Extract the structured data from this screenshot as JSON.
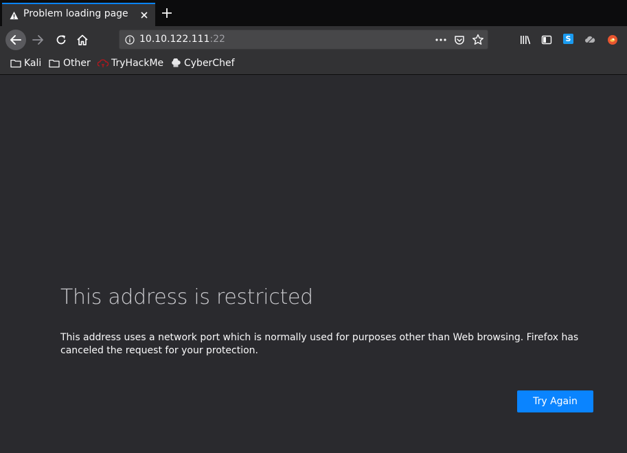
{
  "tab": {
    "title": "Problem loading page"
  },
  "urlbar": {
    "host": "10.10.122.111",
    "port": ":22"
  },
  "bookmarks": [
    {
      "label": "Kali",
      "icon": "folder-icon"
    },
    {
      "label": "Other",
      "icon": "folder-icon"
    },
    {
      "label": "TryHackMe",
      "icon": "tryhackme-icon"
    },
    {
      "label": "CyberChef",
      "icon": "chef-hat-icon"
    }
  ],
  "error": {
    "title": "This address is restricted",
    "description": "This address uses a network port which is normally used for purposes other than Web browsing. Firefox has canceled the request for your protection.",
    "button_label": "Try Again"
  },
  "toolbar": {
    "s_icon_letter": "S"
  },
  "colors": {
    "accent": "#0a84ff",
    "background": "#2a2a2e",
    "toolbar": "#323234"
  }
}
